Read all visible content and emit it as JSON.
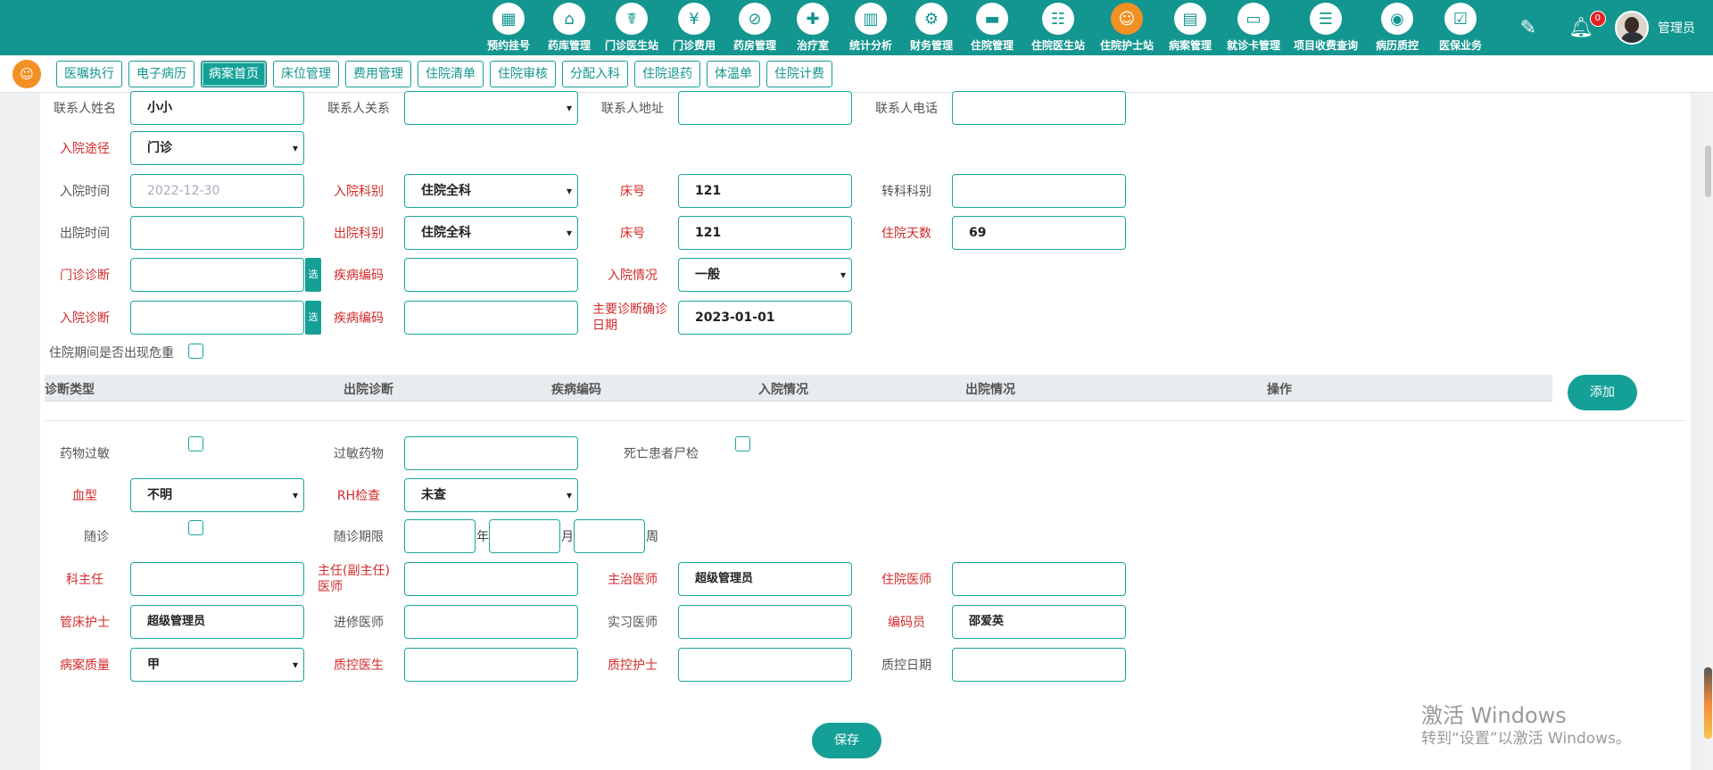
{
  "nav": {
    "items": [
      {
        "label": "预约挂号",
        "icon": "calendar-icon",
        "glyph": "▦"
      },
      {
        "label": "药库管理",
        "icon": "warehouse-icon",
        "glyph": "⌂"
      },
      {
        "label": "门诊医生站",
        "icon": "doctor-icon",
        "glyph": "☤"
      },
      {
        "label": "门诊费用",
        "icon": "yen-icon",
        "glyph": "¥"
      },
      {
        "label": "药房管理",
        "icon": "pill-icon",
        "glyph": "⊘"
      },
      {
        "label": "治疗室",
        "icon": "nurse-icon",
        "glyph": "✚"
      },
      {
        "label": "统计分析",
        "icon": "chart-icon",
        "glyph": "▥"
      },
      {
        "label": "财务管理",
        "icon": "finance-gear-icon",
        "glyph": "⚙"
      },
      {
        "label": "住院管理",
        "icon": "bed-icon",
        "glyph": "▬"
      },
      {
        "label": "住院医生站",
        "icon": "inpatient-doctor-icon",
        "glyph": "☷"
      },
      {
        "label": "住院护士站",
        "icon": "nurse-station-icon",
        "glyph": "☺"
      },
      {
        "label": "病案管理",
        "icon": "record-icon",
        "glyph": "▤"
      },
      {
        "label": "就诊卡管理",
        "icon": "card-icon",
        "glyph": "▭"
      },
      {
        "label": "项目收费查询",
        "icon": "fee-query-icon",
        "glyph": "☰"
      },
      {
        "label": "病历质控",
        "icon": "quality-icon",
        "glyph": "◉"
      },
      {
        "label": "医保业务",
        "icon": "insurance-icon",
        "glyph": "☑"
      }
    ],
    "bell_count": "0",
    "user_name": "管理员"
  },
  "tabs": [
    "医嘱执行",
    "电子病历",
    "病案首页",
    "床位管理",
    "费用管理",
    "住院清单",
    "住院审核",
    "分配入科",
    "住院退药",
    "体温单",
    "住院计费"
  ],
  "form": {
    "contact_name_label": "联系人姓名",
    "contact_name": "小小",
    "contact_relation_label": "联系人关系",
    "contact_relation": "",
    "contact_address_label": "联系人地址",
    "contact_address": "",
    "contact_phone_label": "联系人电话",
    "contact_phone": "",
    "admission_route_label": "入院途径",
    "admission_route": "门诊",
    "admission_time_label": "入院时间",
    "admission_time_placeholder": "2022-12-30",
    "admission_dept_label": "入院科别",
    "admission_dept": "住院全科",
    "bed_no_label": "床号",
    "bed_no": "121",
    "transfer_dept_label": "转科科别",
    "transfer_dept": "",
    "discharge_time_label": "出院时间",
    "discharge_time": "",
    "discharge_dept_label": "出院科别",
    "discharge_dept": "住院全科",
    "bed_no2_label": "床号",
    "bed_no2": "121",
    "stay_days_label": "住院天数",
    "stay_days": "69",
    "outpatient_diag_label": "门诊诊断",
    "outpatient_diag": "",
    "pick_label": "选",
    "disease_code_label": "疾病编码",
    "disease_code": "",
    "admission_condition_label": "入院情况",
    "admission_condition": "一般",
    "admission_diag_label": "入院诊断",
    "admission_diag": "",
    "disease_code2_label": "疾病编码",
    "disease_code2": "",
    "main_diag_date_label": "主要诊断确诊日期",
    "main_diag_date": "2023-01-01",
    "critical_label": "住院期间是否出现危重",
    "drug_allergy_label": "药物过敏",
    "allergy_drug_label": "过敏药物",
    "allergy_drug": "",
    "autopsy_label": "死亡患者尸检",
    "blood_type_label": "血型",
    "blood_type": "不明",
    "rh_label": "RH检查",
    "rh": "未查",
    "followup_label": "随诊",
    "followup_period_label": "随诊期限",
    "unit_year": "年",
    "unit_month": "月",
    "unit_week": "周",
    "dept_director_label": "科主任",
    "dept_director": "",
    "chief_doctor_label": "主任(副主任)医师",
    "chief_doctor": "",
    "attending_doctor_label": "主治医师",
    "attending_doctor": "超级管理员",
    "resident_doctor_label": "住院医师",
    "resident_doctor": "",
    "bed_nurse_label": "管床护士",
    "bed_nurse": "超级管理员",
    "visiting_doctor_label": "进修医师",
    "visiting_doctor": "",
    "intern_doctor_label": "实习医师",
    "intern_doctor": "",
    "coder_label": "编码员",
    "coder": "邵爱英",
    "record_quality_label": "病案质量",
    "record_quality": "甲",
    "qc_doctor_label": "质控医生",
    "qc_doctor": "",
    "qc_nurse_label": "质控护士",
    "qc_nurse": "",
    "qc_date_label": "质控日期",
    "qc_date": ""
  },
  "diag_table": {
    "headers": [
      "诊断类型",
      "出院诊断",
      "疾病编码",
      "入院情况",
      "出院情况",
      "操作"
    ],
    "add_label": "添加"
  },
  "save_label": "保存",
  "watermark": {
    "line1": "激活 Windows",
    "line2": "转到“设置”以激活 Windows。"
  }
}
